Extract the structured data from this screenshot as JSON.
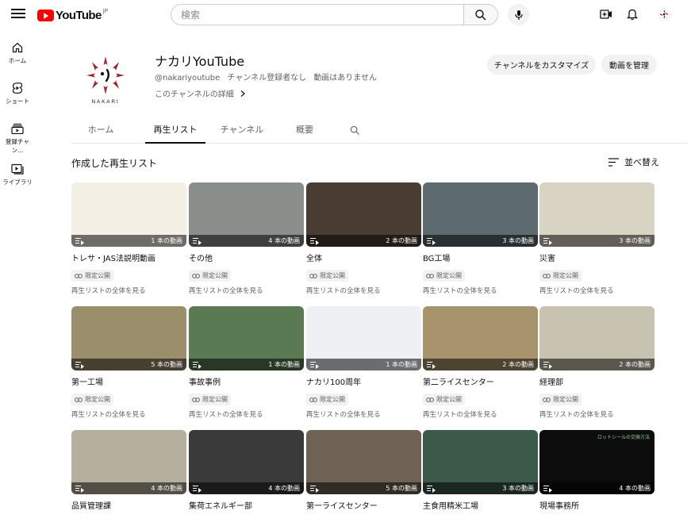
{
  "header": {
    "logo_text": "YouTube",
    "logo_country": "JP",
    "search_placeholder": "検索"
  },
  "rail": [
    {
      "label": "ホーム",
      "icon": "home-icon"
    },
    {
      "label": "ショート",
      "icon": "shorts-icon"
    },
    {
      "label": "登録チャン...",
      "icon": "subscriptions-icon"
    },
    {
      "label": "ライブラリ",
      "icon": "library-icon"
    }
  ],
  "channel": {
    "logo_text": "NAKARI",
    "name": "ナカリYouTube",
    "handle": "@nakariyoutube",
    "subscribers": "チャンネル登録者なし",
    "videos": "動画はありません",
    "details_link": "このチャンネルの詳細",
    "customize_button": "チャンネルをカスタマイズ",
    "manage_button": "動画を管理"
  },
  "tabs": [
    "ホーム",
    "再生リスト",
    "チャンネル",
    "概要"
  ],
  "section": {
    "title": "作成した再生リスト",
    "sort_label": "並べ替え"
  },
  "playlists": [
    {
      "title": "トレサ・JAS法説明動画",
      "count": "1 本の動画",
      "badge": "限定公開",
      "view_all": "再生リストの全体を見る",
      "thumb_color": "#f4f0e6"
    },
    {
      "title": "その他",
      "count": "4 本の動画",
      "badge": "限定公開",
      "view_all": "再生リストの全体を見る",
      "thumb_color": "#8a8f8c"
    },
    {
      "title": "全体",
      "count": "2 本の動画",
      "badge": "限定公開",
      "view_all": "再生リストの全体を見る",
      "thumb_color": "#4a3e34"
    },
    {
      "title": "BG工場",
      "count": "3 本の動画",
      "badge": "限定公開",
      "view_all": "再生リストの全体を見る",
      "thumb_color": "#5d6a70"
    },
    {
      "title": "災害",
      "count": "3 本の動画",
      "badge": "限定公開",
      "view_all": "再生リストの全体を見る",
      "thumb_color": "#d9d3c4"
    },
    {
      "title": "第一工場",
      "count": "5 本の動画",
      "badge": "限定公開",
      "view_all": "再生リストの全体を見る",
      "thumb_color": "#9a8f6a"
    },
    {
      "title": "事故事例",
      "count": "1 本の動画",
      "badge": "限定公開",
      "view_all": "再生リストの全体を見る",
      "thumb_color": "#5a7a54"
    },
    {
      "title": "ナカリ100周年",
      "count": "1 本の動画",
      "badge": "限定公開",
      "view_all": "再生リストの全体を見る",
      "thumb_color": "#eef0f4"
    },
    {
      "title": "第二ライスセンター",
      "count": "2 本の動画",
      "badge": "限定公開",
      "view_all": "再生リストの全体を見る",
      "thumb_color": "#a8946c"
    },
    {
      "title": "経理部",
      "count": "2 本の動画",
      "badge": "限定公開",
      "view_all": "再生リストの全体を見る",
      "thumb_color": "#c8c2b0"
    },
    {
      "title": "品質管理課",
      "count": "4 本の動画",
      "badge": "",
      "view_all": "",
      "thumb_color": "#b5b09e"
    },
    {
      "title": "集荷エネルギー部",
      "count": "4 本の動画",
      "badge": "",
      "view_all": "",
      "thumb_color": "#3a3a3a"
    },
    {
      "title": "第一ライスセンター",
      "count": "5 本の動画",
      "badge": "",
      "view_all": "",
      "thumb_color": "#6e6255"
    },
    {
      "title": "主食用精米工場",
      "count": "3 本の動画",
      "badge": "",
      "view_all": "",
      "thumb_color": "#3c5a4a"
    },
    {
      "title": "現場事務所",
      "count": "4 本の動画",
      "badge": "",
      "view_all": "",
      "thumb_color": "#0c0c0c",
      "thumb_caption": "ロットシールの交換方法"
    }
  ]
}
